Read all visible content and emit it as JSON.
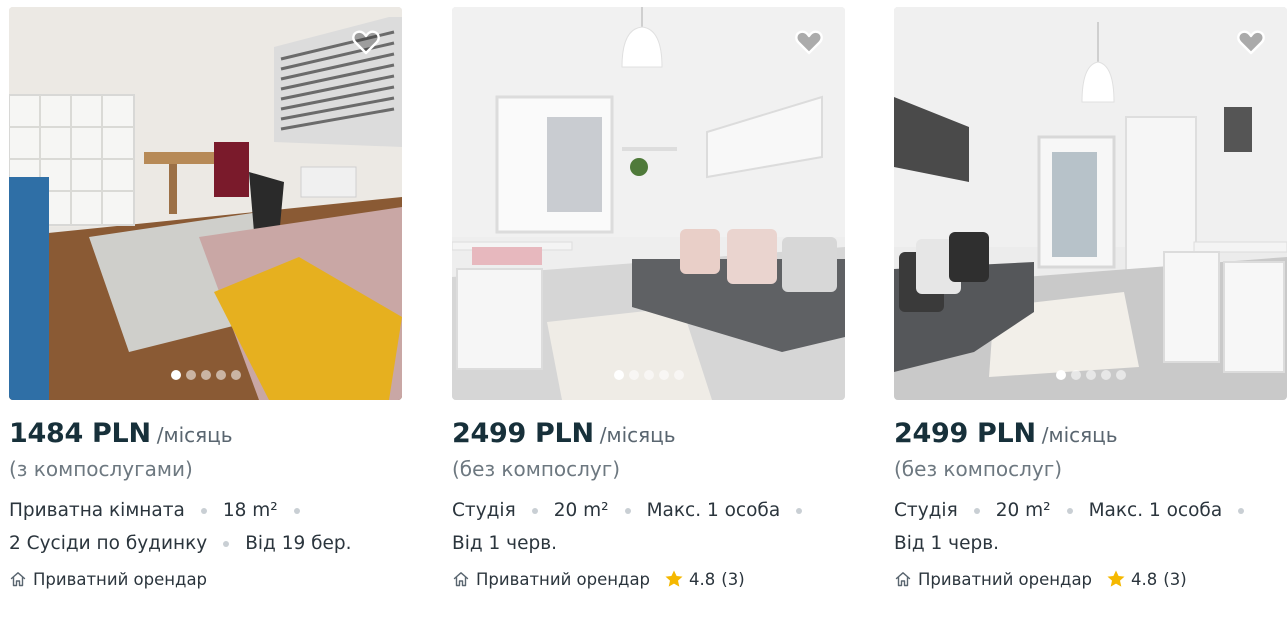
{
  "cards": [
    {
      "price": "1484 PLN",
      "period": "/місяць",
      "fees": "(з компослугами)",
      "facts_row1": [
        "Приватна кімната",
        "18 m²"
      ],
      "facts_row2": [
        "2 Сусіди по будинку",
        "Від 19 бер."
      ],
      "owner": "Приватний орендар",
      "rating": null,
      "reviews": null,
      "photo_count": 5,
      "active_photo": 1,
      "favorite_icon": "heart-outline-icon"
    },
    {
      "price": "2499 PLN",
      "period": "/місяць",
      "fees": "(без компослуг)",
      "facts_row1": [
        "Студія",
        "20 m²",
        "Макс. 1 особа"
      ],
      "facts_row2": [
        "Від 1 черв."
      ],
      "owner": "Приватний орендар",
      "rating": "4.8",
      "reviews": "(3)",
      "photo_count": 5,
      "active_photo": 1,
      "favorite_icon": "heart-outline-icon"
    },
    {
      "price": "2499 PLN",
      "period": "/місяць",
      "fees": "(без компослуг)",
      "facts_row1": [
        "Студія",
        "20 m²",
        "Макс. 1 особа"
      ],
      "facts_row2": [
        "Від 1 черв."
      ],
      "owner": "Приватний орендар",
      "rating": "4.8",
      "reviews": "(3)",
      "photo_count": 5,
      "active_photo": 1,
      "favorite_icon": "heart-outline-icon"
    }
  ],
  "colors": {
    "price": "#17303a",
    "star": "#f5b800",
    "separator": "#c9cfd4"
  }
}
